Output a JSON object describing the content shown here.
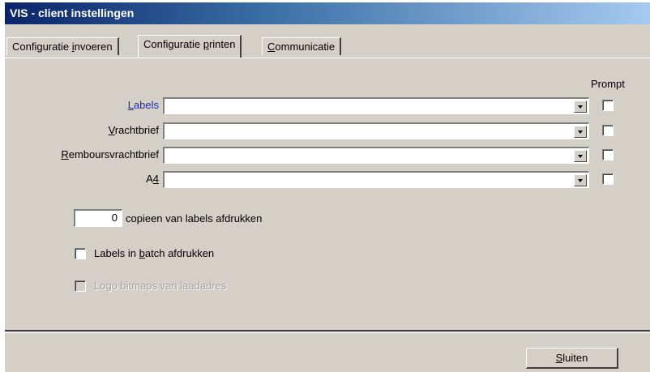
{
  "window": {
    "title": "VIS - client instellingen"
  },
  "tabs": [
    {
      "pre": "Configuratie ",
      "mn": "i",
      "post": "nvoeren"
    },
    {
      "pre": "Configuratie ",
      "mn": "p",
      "post": "rinten"
    },
    {
      "pre": "",
      "mn": "C",
      "post": "ommunicatie"
    }
  ],
  "printers": {
    "prompt_header": "Prompt",
    "rows": [
      {
        "pre": "",
        "mn": "L",
        "post": "abels",
        "value": "",
        "prompt": false
      },
      {
        "pre": "",
        "mn": "V",
        "post": "rachtbrief",
        "value": "",
        "prompt": false
      },
      {
        "pre": "",
        "mn": "R",
        "post": "emboursvrachtbrief",
        "value": "",
        "prompt": false
      },
      {
        "pre": "A",
        "mn": "4",
        "post": "",
        "value": "",
        "prompt": false
      }
    ]
  },
  "copies": {
    "value": "0",
    "label": "copieen van labels afdrukken"
  },
  "batch": {
    "pre": "Labels in ",
    "mn": "b",
    "post": "atch afdrukken",
    "checked": false
  },
  "logo": {
    "pre": "Lo",
    "mn": "g",
    "post": "o bitmaps van laadadres",
    "checked": false,
    "disabled": true
  },
  "footer": {
    "close": {
      "pre": "",
      "mn": "S",
      "post": "luiten"
    }
  }
}
